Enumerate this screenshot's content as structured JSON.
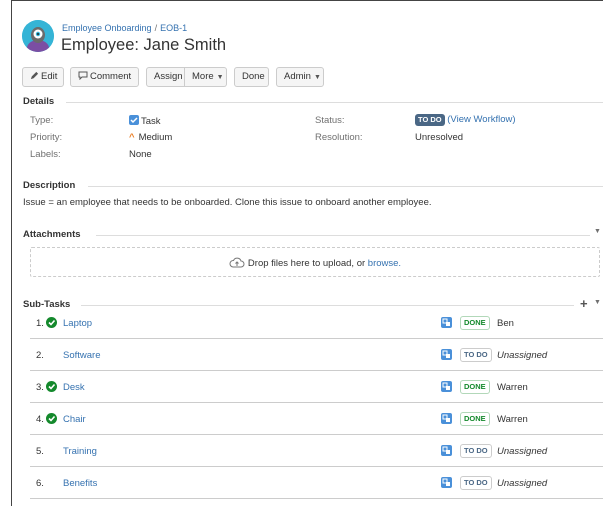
{
  "breadcrumb": {
    "project": "Employee Onboarding",
    "separator": "/",
    "issue_key": "EOB-1"
  },
  "issue": {
    "title": "Employee: Jane Smith"
  },
  "toolbar": {
    "edit": "Edit",
    "comment": "Comment",
    "assign": "Assign",
    "more": "More",
    "done": "Done",
    "admin": "Admin"
  },
  "details": {
    "heading": "Details",
    "type_label": "Type:",
    "type_value": "Task",
    "priority_label": "Priority:",
    "priority_value": "Medium",
    "labels_label": "Labels:",
    "labels_value": "None",
    "status_label": "Status:",
    "status_value": "TO DO",
    "view_workflow": "(View Workflow)",
    "resolution_label": "Resolution:",
    "resolution_value": "Unresolved"
  },
  "description": {
    "heading": "Description",
    "text": "Issue = an employee that needs to be onboarded. Clone this issue to onboard another employee."
  },
  "attachments": {
    "heading": "Attachments",
    "drop_text": "Drop files here to upload, or",
    "browse": "browse."
  },
  "subtasks": {
    "heading": "Sub-Tasks",
    "add": "+",
    "rows": [
      {
        "num": "1.",
        "done": true,
        "name": "Laptop",
        "status": "DONE",
        "assignee": "Ben"
      },
      {
        "num": "2.",
        "done": false,
        "name": "Software",
        "status": "TO DO",
        "assignee": "Unassigned"
      },
      {
        "num": "3.",
        "done": true,
        "name": "Desk",
        "status": "DONE",
        "assignee": "Warren"
      },
      {
        "num": "4.",
        "done": true,
        "name": "Chair",
        "status": "DONE",
        "assignee": "Warren"
      },
      {
        "num": "5.",
        "done": false,
        "name": "Training",
        "status": "TO DO",
        "assignee": "Unassigned"
      },
      {
        "num": "6.",
        "done": false,
        "name": "Benefits",
        "status": "TO DO",
        "assignee": "Unassigned"
      }
    ]
  },
  "icons": [
    "project-avatar-icon",
    "pencil-icon",
    "comment-icon",
    "checkbox-icon",
    "priority-up-icon",
    "cloud-upload-icon",
    "check-circle-icon",
    "subtask-icon",
    "chevron-down-icon",
    "plus-icon"
  ],
  "colors": {
    "link": "#3572b0",
    "todo": "#4a6785",
    "done": "#14892c",
    "avatar": "#35b4d6"
  }
}
